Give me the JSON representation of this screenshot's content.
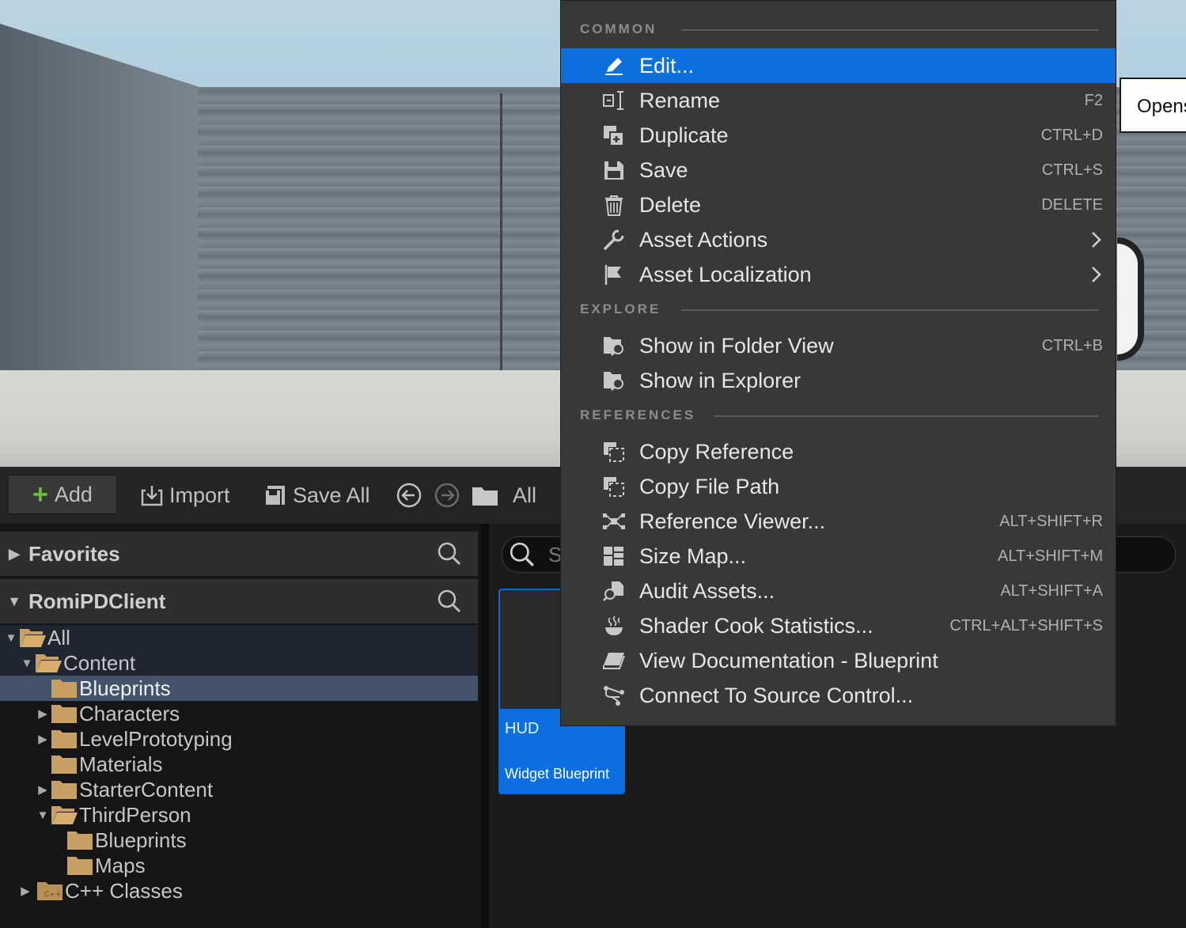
{
  "tooltip": {
    "text": "Opens"
  },
  "toolbar": {
    "add": "Add",
    "import": "Import",
    "save_all": "Save All",
    "path": "All"
  },
  "left_panel": {
    "favorites": "Favorites",
    "project": "RomiPDClient",
    "tree": [
      {
        "label": "All"
      },
      {
        "label": "Content"
      },
      {
        "label": "Blueprints"
      },
      {
        "label": "Characters"
      },
      {
        "label": "LevelPrototyping"
      },
      {
        "label": "Materials"
      },
      {
        "label": "StarterContent"
      },
      {
        "label": "ThirdPerson"
      },
      {
        "label": "Blueprints"
      },
      {
        "label": "Maps"
      },
      {
        "label": "C++ Classes"
      }
    ]
  },
  "content": {
    "search_placeholder": "Se",
    "asset": {
      "name": "HUD",
      "type": "Widget Blueprint"
    }
  },
  "menu": {
    "sections": {
      "common": "COMMON",
      "explore": "EXPLORE",
      "references": "REFERENCES"
    },
    "items": [
      {
        "label": "Edit...",
        "shortcut": "",
        "icon": "pencil-icon"
      },
      {
        "label": "Rename",
        "shortcut": "F2",
        "icon": "rename-icon"
      },
      {
        "label": "Duplicate",
        "shortcut": "CTRL+D",
        "icon": "duplicate-icon"
      },
      {
        "label": "Save",
        "shortcut": "CTRL+S",
        "icon": "save-icon"
      },
      {
        "label": "Delete",
        "shortcut": "DELETE",
        "icon": "trash-icon"
      },
      {
        "label": "Asset Actions",
        "shortcut": "",
        "icon": "wrench-icon"
      },
      {
        "label": "Asset Localization",
        "shortcut": "",
        "icon": "flag-icon"
      },
      {
        "label": "Show in Folder View",
        "shortcut": "CTRL+B",
        "icon": "folder-search-icon"
      },
      {
        "label": "Show in Explorer",
        "shortcut": "",
        "icon": "folder-search-icon"
      },
      {
        "label": "Copy Reference",
        "shortcut": "",
        "icon": "copy-icon"
      },
      {
        "label": "Copy File Path",
        "shortcut": "",
        "icon": "copy-icon"
      },
      {
        "label": "Reference Viewer...",
        "shortcut": "ALT+SHIFT+R",
        "icon": "graph-icon"
      },
      {
        "label": "Size Map...",
        "shortcut": "ALT+SHIFT+M",
        "icon": "sizemap-icon"
      },
      {
        "label": "Audit Assets...",
        "shortcut": "ALT+SHIFT+A",
        "icon": "audit-icon"
      },
      {
        "label": "Shader Cook Statistics...",
        "shortcut": "CTRL+ALT+SHIFT+S",
        "icon": "steam-icon"
      },
      {
        "label": "View Documentation - Blueprint",
        "shortcut": "",
        "icon": "book-icon"
      },
      {
        "label": "Connect To Source Control...",
        "shortcut": "",
        "icon": "source-control-icon"
      }
    ]
  },
  "colors": {
    "accent": "#0c70dc",
    "folder": "#c9a063",
    "add_plus": "#6cbf3a"
  }
}
